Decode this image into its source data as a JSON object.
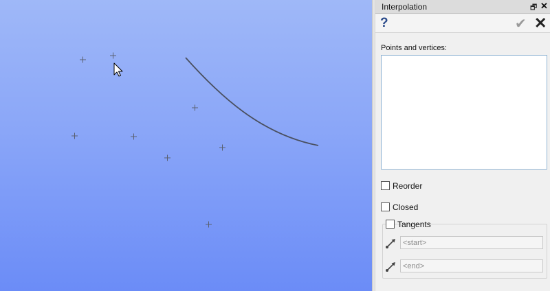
{
  "panel": {
    "title": "Interpolation",
    "float_icon": "restore-window-icon",
    "close_icon": "close-icon"
  },
  "toolbar": {
    "help_icon": "help-icon",
    "ok_icon": "checkmark-icon",
    "cancel_icon": "cancel-x-icon"
  },
  "form": {
    "points_label": "Points and vertices:",
    "reorder_label": "Reorder",
    "closed_label": "Closed",
    "tangents_label": "Tangents",
    "start_placeholder": "<start>",
    "end_placeholder": "<end>"
  },
  "colors": {
    "viewport_top": "#9fb8f8",
    "viewport_bottom": "#6b8cf7",
    "curve": "#4a5060",
    "point_marker": "#5a6070"
  }
}
